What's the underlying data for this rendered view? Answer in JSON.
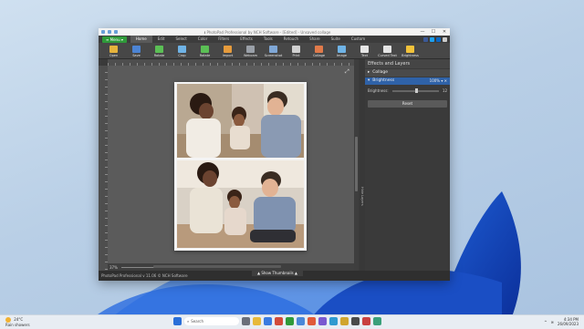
{
  "window": {
    "title": "ℹ PhotoPad Professional by NCH Software - [Edited] - Unsaved collage",
    "controls": [
      "—",
      "☐",
      "✕"
    ]
  },
  "menu": {
    "menu_button": "≡ Menu ▾",
    "tabs": [
      "Home",
      "Edit",
      "Select",
      "Color",
      "Filters",
      "Effects",
      "Tools",
      "Retouch",
      "Share",
      "Suite",
      "Custom"
    ],
    "active_tab": "Home"
  },
  "toolbar": {
    "items": [
      {
        "label": "Open",
        "icon": "folder-icon",
        "color": "#e6b33c"
      },
      {
        "label": "Save",
        "icon": "floppy-icon",
        "color": "#4c84d4"
      },
      {
        "label": "Rotate",
        "icon": "rotate-icon",
        "color": "#5bbf55"
      },
      {
        "label": "Crop",
        "icon": "crop-icon",
        "color": "#6fb3e6"
      },
      {
        "label": "Rotate",
        "icon": "rotate-right-icon",
        "color": "#5bbf55"
      },
      {
        "label": "Import",
        "icon": "import-icon",
        "color": "#e69b3c"
      },
      {
        "label": "Webcam",
        "icon": "webcam-icon",
        "color": "#9aa0a8"
      },
      {
        "label": "Screenshot",
        "icon": "screenshot-icon",
        "color": "#7fa7d6"
      },
      {
        "label": "Print",
        "icon": "printer-icon",
        "color": "#d0d0d0"
      },
      {
        "label": "Collage",
        "icon": "collage-icon",
        "color": "#e07a4a"
      },
      {
        "label": "Image",
        "icon": "image-icon",
        "color": "#6fb3e6"
      },
      {
        "label": "Text",
        "icon": "text-icon",
        "color": "#e5e5e5"
      },
      {
        "label": "Curved Text",
        "icon": "curved-text-icon",
        "color": "#e5e5e5"
      },
      {
        "label": "Brightness",
        "icon": "sun-icon",
        "color": "#f2c23a"
      }
    ]
  },
  "editor": {
    "zoom": "37%",
    "show_thumbnails": "▲ Show Thumbnails ▲",
    "status": "PhotoPad Professional v 11.06 © NCH Software",
    "hide_panel": "Hide Layers"
  },
  "panel": {
    "header": "Effects and Layers",
    "sections": [
      {
        "name": "Collage",
        "active": false
      },
      {
        "name": "Brightness",
        "active": true,
        "value": "100% ▾ ✕"
      }
    ],
    "brightness_label": "Brightness:",
    "brightness_value": "12",
    "brightness_level": 0.5,
    "reset": "Reset"
  },
  "taskbar": {
    "weather_temp": "24°C",
    "weather_desc": "Rain showers",
    "search": "Search",
    "time": "4:34 PM",
    "date": "26/09/2023"
  }
}
